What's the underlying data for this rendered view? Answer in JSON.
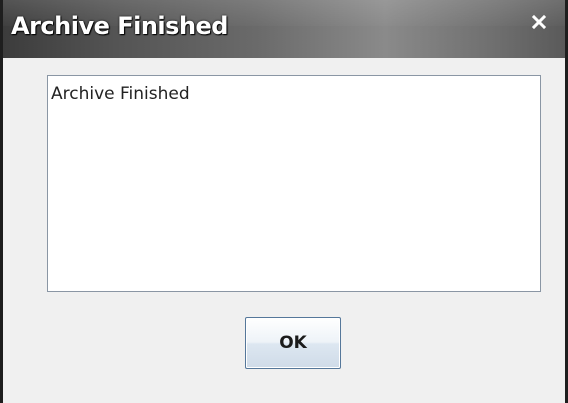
{
  "window": {
    "title": "Archive Finished",
    "close_icon": "close-icon"
  },
  "message": {
    "text": "Archive Finished"
  },
  "buttons": {
    "ok_label": "OK"
  },
  "colors": {
    "titlebar_dark": "#3c3c3c",
    "titlebar_light": "#8a8a8a",
    "dialog_background": "#f0f0f0",
    "text_area_border": "#8a96a4",
    "button_border": "#55779a"
  }
}
